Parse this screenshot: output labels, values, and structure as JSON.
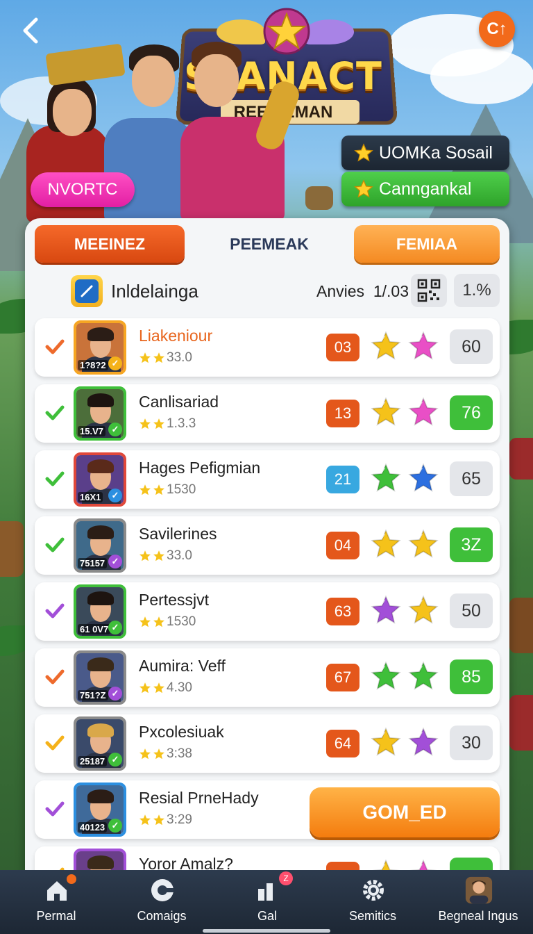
{
  "header": {
    "back_icon": "chevron-left-icon",
    "corner_button": "C↑",
    "logo_title": "SPANACT",
    "logo_subtitle": "REE PEMAN",
    "pink_badge": "NVORTC",
    "chip_dark": "UOMKa Sosail",
    "chip_green": "Canngankal"
  },
  "tabs": [
    {
      "label": "MEEINEZ",
      "active": true
    },
    {
      "label": "PEEMEAK",
      "active": false
    },
    {
      "label": "FEMIAA",
      "active": false
    }
  ],
  "list_header": {
    "title": "Inldelainga",
    "label": "Anvies",
    "value": "1/.03",
    "qr_icon": "qr-code-icon",
    "button": "1.%"
  },
  "rows": [
    {
      "name": "Liakeniour",
      "name_color": "#e8651d",
      "level": "1?8?2",
      "sub": "33.0",
      "pill": "03",
      "pill_color": "#e4571b",
      "star1": "#f5c21a",
      "star2": "#e94fc6",
      "score": "60",
      "score_style": "grey",
      "check": "#ee6a2c",
      "avatar_border": "#f6a623",
      "badge_color": "#f5b21a"
    },
    {
      "name": "Canlisariad",
      "name_color": "#222222",
      "level": "15.V7",
      "sub": "1.3.3",
      "pill": "13",
      "pill_color": "#e4571b",
      "star1": "#f5c21a",
      "star2": "#e94fc6",
      "score": "76",
      "score_style": "green",
      "check": "#3fbf3a",
      "avatar_border": "#3fbf3a",
      "badge_color": "#3fbf3a"
    },
    {
      "name": "Hages Pefigmian",
      "name_color": "#222222",
      "level": "16X1",
      "sub": "1530",
      "pill": "21",
      "pill_color": "#38a8e0",
      "star1": "#3fbf3a",
      "star2": "#2c6fe0",
      "score": "65",
      "score_style": "grey",
      "check": "#3fbf3a",
      "avatar_border": "#e0483a",
      "badge_color": "#2c8fe0"
    },
    {
      "name": "Savilerines",
      "name_color": "#222222",
      "level": "75157",
      "sub": "33.0",
      "pill": "04",
      "pill_color": "#e4571b",
      "star1": "#f5c21a",
      "star2": "#f5c21a",
      "score": "3Z",
      "score_style": "green",
      "check": "#3fbf3a",
      "avatar_border": "#8a8a8a",
      "badge_color": "#a24fd8"
    },
    {
      "name": "Pertessjvt",
      "name_color": "#222222",
      "level": "61 0V7",
      "sub": "1530",
      "pill": "63",
      "pill_color": "#e4571b",
      "star1": "#a24fd8",
      "star2": "#f5c21a",
      "score": "50",
      "score_style": "grey",
      "check": "#a24fd8",
      "avatar_border": "#3fbf3a",
      "badge_color": "#3fbf3a"
    },
    {
      "name": "Aumira: Veff",
      "name_color": "#222222",
      "level": "751?Z",
      "sub": "4.30",
      "pill": "67",
      "pill_color": "#e4571b",
      "star1": "#3fbf3a",
      "star2": "#3fbf3a",
      "score": "85",
      "score_style": "green",
      "check": "#ee6a2c",
      "avatar_border": "#8a8a8a",
      "badge_color": "#a24fd8"
    },
    {
      "name": "Pxcolesiuak",
      "name_color": "#222222",
      "level": "25187",
      "sub": "3:38",
      "pill": "64",
      "pill_color": "#e4571b",
      "star1": "#f5c21a",
      "star2": "#a24fd8",
      "score": "30",
      "score_style": "grey",
      "check": "#f5b21a",
      "avatar_border": "#8a8a8a",
      "badge_color": "#3fbf3a"
    },
    {
      "name": "Resial PrneHady",
      "name_color": "#222222",
      "level": "40123",
      "sub": "3:29",
      "cta": "GOM_ED",
      "check": "#a24fd8",
      "avatar_border": "#2c8fe0",
      "badge_color": "#3fbf3a"
    },
    {
      "name": "Yoror Amalz?",
      "name_color": "#222222",
      "level": "",
      "sub": "",
      "pill": "",
      "pill_color": "#e4571b",
      "star1": "#f5c21a",
      "star2": "#e94fc6",
      "score": "",
      "score_style": "green",
      "check": "#f5b21a",
      "avatar_border": "#a24fd8",
      "badge_color": "#3fbf3a"
    }
  ],
  "bottom_nav": [
    {
      "label": "Permal",
      "icon": "home-icon",
      "badge": ""
    },
    {
      "label": "Comaigs",
      "icon": "compass-icon",
      "badge": ""
    },
    {
      "label": "Gal",
      "icon": "chart-icon",
      "badge": "Z"
    },
    {
      "label": "Semitics",
      "icon": "gear-icon",
      "badge": ""
    },
    {
      "label": "Begneal Ingus",
      "icon": "avatar-icon",
      "badge": ""
    }
  ],
  "colors": {
    "accent_orange": "#f26a1b",
    "accent_green": "#3fbf3a",
    "panel": "#f4f6f8",
    "nav": "#1d2734"
  }
}
